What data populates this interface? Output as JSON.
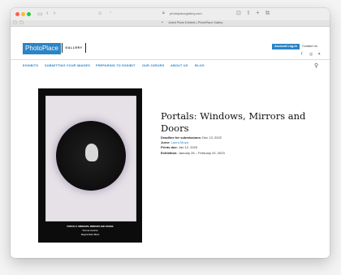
{
  "browser": {
    "url": "photoplacegallery.com",
    "tab_title": "Juried Photo Exhibits | PhotoPlace Gallery",
    "icons": {
      "back": "chevron-left-icon",
      "forward": "chevron-right-icon",
      "home": "home-icon",
      "shield": "shield-icon",
      "share": "share-icon",
      "new_tab": "plus-icon",
      "tabs": "tabs-icon",
      "sidebar": "sidebar-icon"
    }
  },
  "site": {
    "logo_text": "PhotoPlace",
    "logo_gallery": "GALLERY",
    "brand_color": "#2b84c6",
    "login_label": "Account Log-in",
    "contact_label": "Contact Us",
    "social": [
      "facebook-icon",
      "instagram-icon",
      "twitter-icon"
    ]
  },
  "nav": {
    "items": [
      "EXHIBITS",
      "SUBMITTING YOUR IMAGES",
      "PREPARING TO EXHIBIT",
      "OUR JURORS",
      "ABOUT US",
      "BLOG"
    ]
  },
  "exhibit": {
    "title": "Portals: Windows, Mirrors and Doors",
    "deadline_label": "Deadline for submissions:",
    "deadline_value": "Dec 13, 2022",
    "juror_label": "Juror:",
    "juror_value": "Laura Moya",
    "prints_label": "Prints due:",
    "prints_value": "Jan 12, 2023",
    "exhibition_label": "Exhibition:",
    "exhibition_value": "January 26 – February 24, 2023",
    "poster_line1": "PORTALS: WINDOWS, MIRRORS AND DOORS",
    "poster_line2": "Thomas Gardner",
    "poster_line3": "Magical Ellen Black"
  }
}
